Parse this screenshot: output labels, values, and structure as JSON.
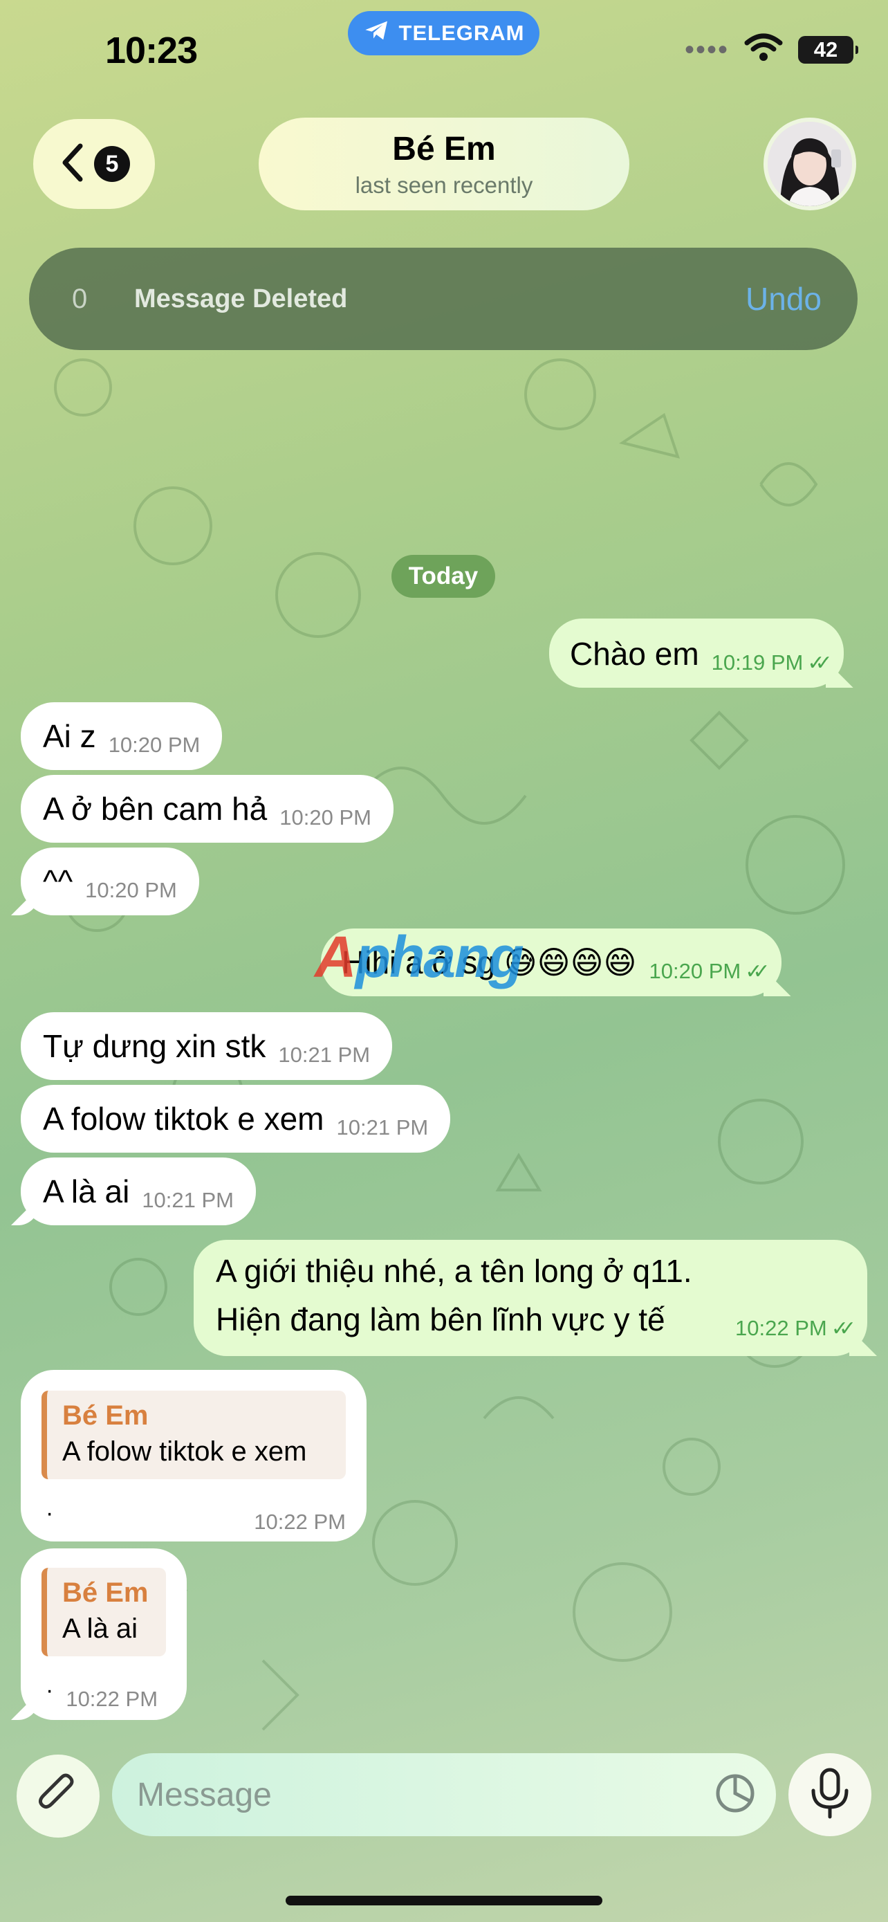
{
  "status_bar": {
    "time": "10:23",
    "pill_label": "TELEGRAM",
    "battery": "42"
  },
  "header": {
    "back_count": "5",
    "chat_name": "Bé Em",
    "chat_status": "last seen recently"
  },
  "toast": {
    "count": "0",
    "text": "Message Deleted",
    "action": "Undo"
  },
  "day_separator": "Today",
  "messages": [
    {
      "dir": "out",
      "text": "Chào em",
      "time": "10:19 PM"
    },
    {
      "dir": "in",
      "text": "Ai z",
      "time": "10:20 PM"
    },
    {
      "dir": "in",
      "text": "A ở bên cam hả",
      "time": "10:20 PM"
    },
    {
      "dir": "in",
      "text": "^^",
      "time": "10:20 PM"
    },
    {
      "dir": "out",
      "text": "Hihi a ở sg 😅😄😄😄",
      "time": "10:20 PM"
    },
    {
      "dir": "in",
      "text": "Tự dưng xin stk",
      "time": "10:21 PM"
    },
    {
      "dir": "in",
      "text": "A folow tiktok e xem",
      "time": "10:21 PM"
    },
    {
      "dir": "in",
      "text": "A là ai",
      "time": "10:21 PM"
    },
    {
      "dir": "out",
      "text_line1": "A giới thiệu nhé, a tên long ở q11.",
      "text_line2": "Hiện đang làm bên lĩnh vực y tế",
      "time": "10:22 PM"
    },
    {
      "dir": "in",
      "reply_name": "Bé Em",
      "reply_text": "A folow tiktok e xem",
      "text": "·",
      "time": "10:22 PM"
    },
    {
      "dir": "in",
      "reply_name": "Bé Em",
      "reply_text": "A là ai",
      "text": "·",
      "time": "10:22 PM"
    }
  ],
  "watermark": {
    "part1": "A",
    "part2": "phang"
  },
  "composer": {
    "placeholder": "Message"
  },
  "colors": {
    "accent_blue": "#3d8ef0",
    "outgoing_bubble": "#e4fbd0",
    "incoming_bubble": "#ffffff",
    "tick_green": "#4aa64e",
    "reply_orange": "#d8803f",
    "undo_blue": "#6cb2e8"
  },
  "icons": [
    "telegram-icon",
    "wifi-icon",
    "battery-icon",
    "chevron-left-icon",
    "paperclip-icon",
    "sticker-icon",
    "microphone-icon",
    "double-check-icon"
  ]
}
